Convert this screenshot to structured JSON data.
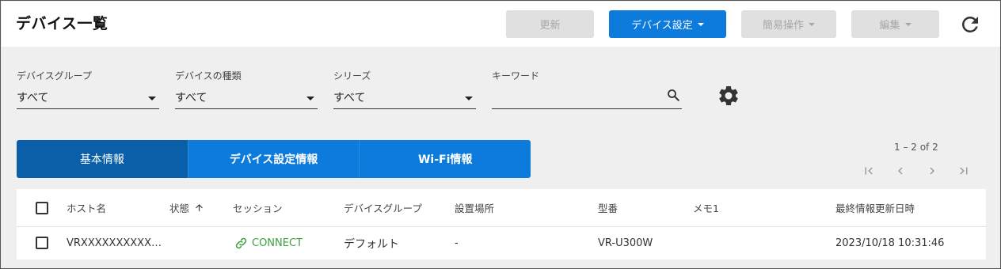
{
  "header": {
    "title": "デバイス一覧",
    "refresh_label": "更新",
    "device_settings_label": "デバイス設定",
    "simple_ops_label": "簡易操作",
    "edit_label": "編集"
  },
  "filters": {
    "device_group": {
      "label": "デバイスグループ",
      "value": "すべて"
    },
    "device_type": {
      "label": "デバイスの種類",
      "value": "すべて"
    },
    "series": {
      "label": "シリーズ",
      "value": "すべて"
    },
    "keyword": {
      "label": "キーワード",
      "value": ""
    }
  },
  "tabs": [
    {
      "label": "基本情報"
    },
    {
      "label": "デバイス設定情報"
    },
    {
      "label": "Wi-Fi情報"
    }
  ],
  "pagination": {
    "range_text": "1 – 2 of 2"
  },
  "table": {
    "columns": {
      "host": "ホスト名",
      "status": "状態",
      "session": "セッション",
      "group": "デバイスグループ",
      "location": "設置場所",
      "model": "型番",
      "memo": "メモ1",
      "updated": "最終情報更新日時"
    },
    "rows": [
      {
        "host": "VRXXXXXXXXXXX…",
        "status": "",
        "session": "CONNECT",
        "group": "デフォルト",
        "location": "-",
        "model": "VR-U300W",
        "memo": "",
        "updated": "2023/10/18 10:31:46"
      }
    ]
  },
  "colors": {
    "primary": "#0c7bdc",
    "tab_active": "#0a5fa8",
    "connect_green": "#3ca03c",
    "disabled_bg": "#e0e0e0"
  }
}
